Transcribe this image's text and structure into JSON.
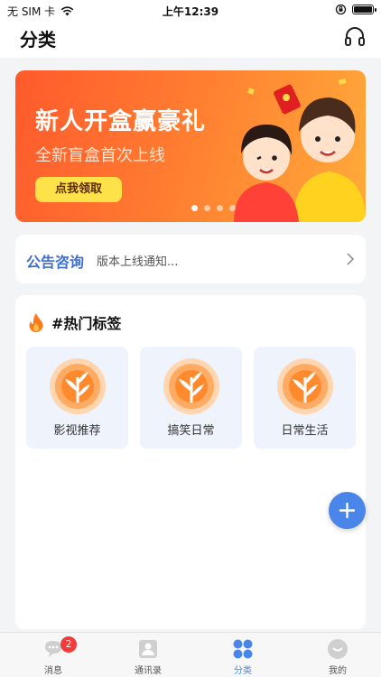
{
  "status_bar": {
    "carrier": "无 SIM 卡",
    "time": "上午12:39"
  },
  "header": {
    "title": "分类",
    "headset_icon": "headset-icon"
  },
  "banner": {
    "title": "新人开盒赢豪礼",
    "subtitle": "全新盲盒首次上线",
    "button_label": "点我领取",
    "dots_total": 4,
    "active_dot": 1
  },
  "notice": {
    "label": "公告咨询",
    "text": "版本上线通知..."
  },
  "hot_tags": {
    "title": "#热门标签",
    "items": [
      {
        "label": "影视推荐"
      },
      {
        "label": "搞笑日常"
      },
      {
        "label": "日常生活"
      }
    ]
  },
  "tabbar": {
    "items": [
      {
        "label": "消息",
        "badge": "2",
        "icon": "message-icon"
      },
      {
        "label": "通讯录",
        "icon": "contacts-icon"
      },
      {
        "label": "分类",
        "icon": "category-icon"
      },
      {
        "label": "我的",
        "icon": "profile-icon"
      }
    ],
    "active": "分类"
  },
  "colors": {
    "accent": "#4a86ea",
    "notice_label": "#3e6fd1",
    "badge": "#f23b3b",
    "banner_button": "#ffe14a"
  }
}
